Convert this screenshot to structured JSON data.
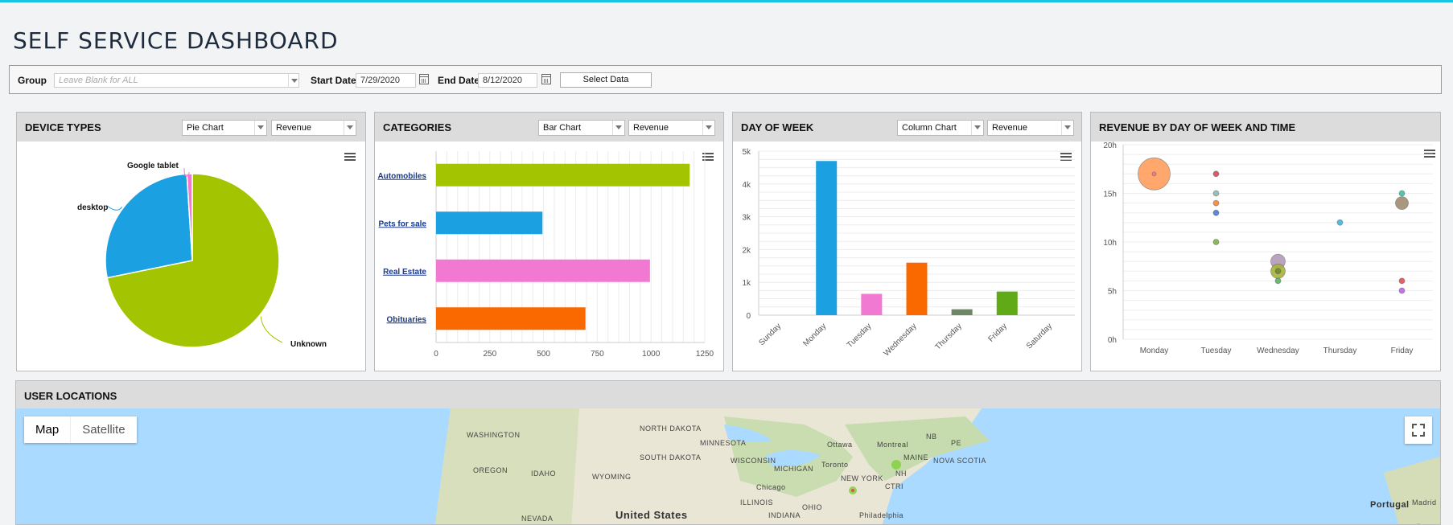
{
  "page": {
    "title": "SELF SERVICE DASHBOARD"
  },
  "filters": {
    "group_label": "Group",
    "group_placeholder": "Leave Blank for ALL",
    "start_label": "Start Date",
    "start_value": "7/29/2020",
    "end_label": "End Date",
    "end_value": "8/12/2020",
    "select_button": "Select Data"
  },
  "panels": {
    "device": {
      "title": "DEVICE TYPES",
      "chart_type": "Pie Chart",
      "metric": "Revenue"
    },
    "categories": {
      "title": "CATEGORIES",
      "chart_type": "Bar Chart",
      "metric": "Revenue"
    },
    "dow": {
      "title": "DAY OF WEEK",
      "chart_type": "Column Chart",
      "metric": "Revenue"
    },
    "bubble": {
      "title": "REVENUE BY DAY OF WEEK AND TIME"
    }
  },
  "map": {
    "title": "USER LOCATIONS",
    "map_button": "Map",
    "satellite_button": "Satellite",
    "labels": [
      "WASHINGTON",
      "NORTH DAKOTA",
      "MINNESOTA",
      "Ottawa",
      "Montreal",
      "NB",
      "PE",
      "OREGON",
      "IDAHO",
      "SOUTH DAKOTA",
      "WISCONSIN",
      "MICHIGAN",
      "Toronto",
      "MAINE",
      "NOVA SCOTIA",
      "WYOMING",
      "NEW YORK",
      "NH",
      "Chicago",
      "CT",
      "RI",
      "ILLINOIS",
      "INDIANA",
      "OHIO",
      "Philadelphia",
      "NEVADA",
      "United States",
      "Portugal",
      "Madrid"
    ]
  },
  "colors": {
    "green": "#a3c400",
    "blue": "#1ba1e2",
    "pink": "#f279d2",
    "orange": "#fa6800",
    "gray": "#6d8764",
    "lime": "#60a917"
  },
  "chart_data": [
    {
      "type": "pie",
      "title": "DEVICE TYPES",
      "slices": [
        {
          "label": "Unknown",
          "value": 71.8,
          "color": "#a3c400"
        },
        {
          "label": "desktop",
          "value": 27.2,
          "color": "#1ba1e2"
        },
        {
          "label": "Google tablet",
          "value": 1.0,
          "color": "#f279d2"
        }
      ]
    },
    {
      "type": "bar",
      "title": "CATEGORIES",
      "orientation": "horizontal",
      "categories": [
        "Automobiles",
        "Pets for sale",
        "Real Estate",
        "Obituaries"
      ],
      "values": [
        1180,
        495,
        995,
        695
      ],
      "colors": [
        "#a3c400",
        "#1ba1e2",
        "#f279d2",
        "#fa6800"
      ],
      "xlim": [
        0,
        1250
      ],
      "xticks": [
        "0",
        "250",
        "500",
        "750",
        "1000",
        "1250"
      ]
    },
    {
      "type": "bar",
      "title": "DAY OF WEEK",
      "categories": [
        "Sunday",
        "Monday",
        "Tuesday",
        "Wednesday",
        "Thursday",
        "Friday",
        "Saturday"
      ],
      "values": [
        0,
        4700,
        650,
        1600,
        180,
        720,
        0
      ],
      "colors": [
        "#a3c400",
        "#1ba1e2",
        "#f279d2",
        "#fa6800",
        "#6d8764",
        "#60a917",
        "#a3c400"
      ],
      "ylim": [
        0,
        5000
      ],
      "yticks": [
        "0",
        "1k",
        "2k",
        "3k",
        "4k",
        "5k"
      ]
    },
    {
      "type": "scatter",
      "title": "REVENUE BY DAY OF WEEK AND TIME",
      "categories": [
        "Monday",
        "Tuesday",
        "Wednesday",
        "Thursday",
        "Friday"
      ],
      "ylim": [
        0,
        20
      ],
      "yticks": [
        "0h",
        "5h",
        "10h",
        "15h",
        "20h"
      ],
      "points": [
        {
          "x": "Monday",
          "y": 17,
          "size": 40,
          "color": "#ff9d5c"
        },
        {
          "x": "Monday",
          "y": 17,
          "size": 5,
          "color": "#f4798a"
        },
        {
          "x": "Tuesday",
          "y": 17,
          "size": 7,
          "color": "#d04b5e"
        },
        {
          "x": "Tuesday",
          "y": 15,
          "size": 7,
          "color": "#8fb6b1"
        },
        {
          "x": "Tuesday",
          "y": 14,
          "size": 7,
          "color": "#f08a3a"
        },
        {
          "x": "Tuesday",
          "y": 13,
          "size": 7,
          "color": "#4d78d8"
        },
        {
          "x": "Tuesday",
          "y": 10,
          "size": 7,
          "color": "#7cb342"
        },
        {
          "x": "Wednesday",
          "y": 8,
          "size": 18,
          "color": "#b39bb8"
        },
        {
          "x": "Wednesday",
          "y": 7,
          "size": 18,
          "color": "#a7b43c"
        },
        {
          "x": "Wednesday",
          "y": 6,
          "size": 7,
          "color": "#58b55e"
        },
        {
          "x": "Wednesday",
          "y": 7,
          "size": 7,
          "color": "#6d8b2c"
        },
        {
          "x": "Thursday",
          "y": 12,
          "size": 7,
          "color": "#3cb6e3"
        },
        {
          "x": "Friday",
          "y": 15,
          "size": 7,
          "color": "#3ec0a8"
        },
        {
          "x": "Friday",
          "y": 14,
          "size": 16,
          "color": "#a08c72"
        },
        {
          "x": "Friday",
          "y": 6,
          "size": 7,
          "color": "#e3514f"
        },
        {
          "x": "Friday",
          "y": 5,
          "size": 7,
          "color": "#c162e8"
        }
      ]
    }
  ]
}
